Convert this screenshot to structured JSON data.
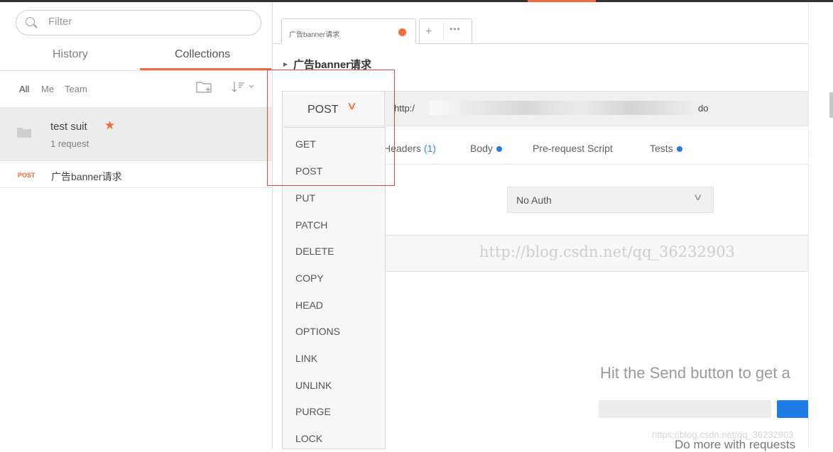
{
  "sidebar": {
    "filter_placeholder": "Filter",
    "tabs": {
      "history": "History",
      "collections": "Collections"
    },
    "filters": {
      "all": "All",
      "me": "Me",
      "team": "Team"
    },
    "collection": {
      "name": "test suit",
      "count": "1 request"
    },
    "request": {
      "method": "POST",
      "name": "广告banner请求"
    }
  },
  "main": {
    "tab_label": "广告banner请求",
    "request_title": "广告banner请求",
    "method": "POST",
    "url_prefix": "http:/",
    "url_suffix": "do",
    "subtabs": {
      "headers": "Headers",
      "headers_count": "(1)",
      "body": "Body",
      "prerequest": "Pre-request Script",
      "tests": "Tests"
    },
    "auth_value": "No Auth",
    "watermark": "http://blog.csdn.net/qq_36232903",
    "hint": "Hit the Send button to get a",
    "do_more": "Do more with requests",
    "csdn_mark": "https://blog.csdn.net/qq_36232903"
  },
  "dropdown": {
    "items": [
      "GET",
      "POST",
      "PUT",
      "PATCH",
      "DELETE",
      "COPY",
      "HEAD",
      "OPTIONS",
      "LINK",
      "UNLINK",
      "PURGE",
      "LOCK"
    ]
  },
  "colors": {
    "accent": "#f26b3a",
    "blue": "#1f7be6",
    "highlight": "#e04545"
  }
}
